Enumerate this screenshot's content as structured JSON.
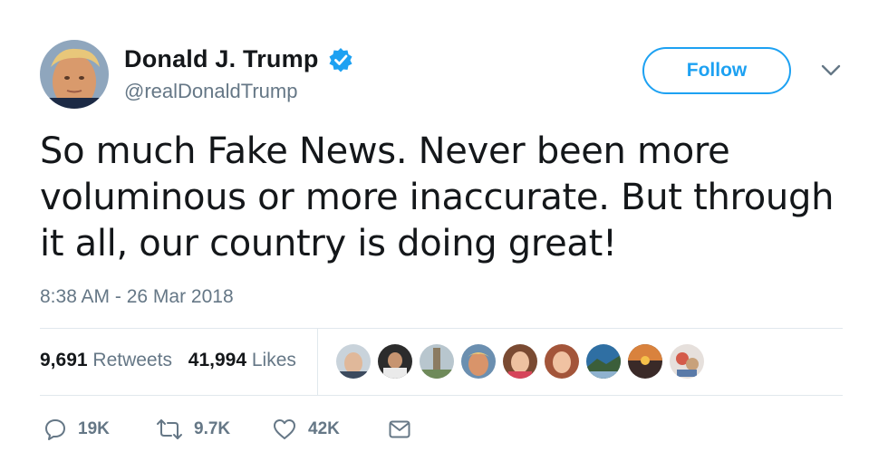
{
  "user": {
    "display_name": "Donald J. Trump",
    "handle": "@realDonaldTrump",
    "verified": true,
    "avatar_icon": "profile-photo"
  },
  "header": {
    "follow_label": "Follow",
    "more_icon": "chevron-down-icon"
  },
  "tweet": {
    "text": "So much Fake News. Never been more voluminous or more inaccurate. But through it all, our country is doing great!",
    "timestamp": "8:38 AM - 26 Mar 2018"
  },
  "stats": {
    "retweets_count": "9,691",
    "retweets_label": "Retweets",
    "likes_count": "41,994",
    "likes_label": "Likes",
    "liker_avatars": 9
  },
  "actions": {
    "reply_count": "19K",
    "retweet_count": "9.7K",
    "like_count": "42K"
  },
  "colors": {
    "accent": "#1da1f2",
    "text": "#14171a",
    "muted": "#657786",
    "divider": "#e1e8ed"
  }
}
